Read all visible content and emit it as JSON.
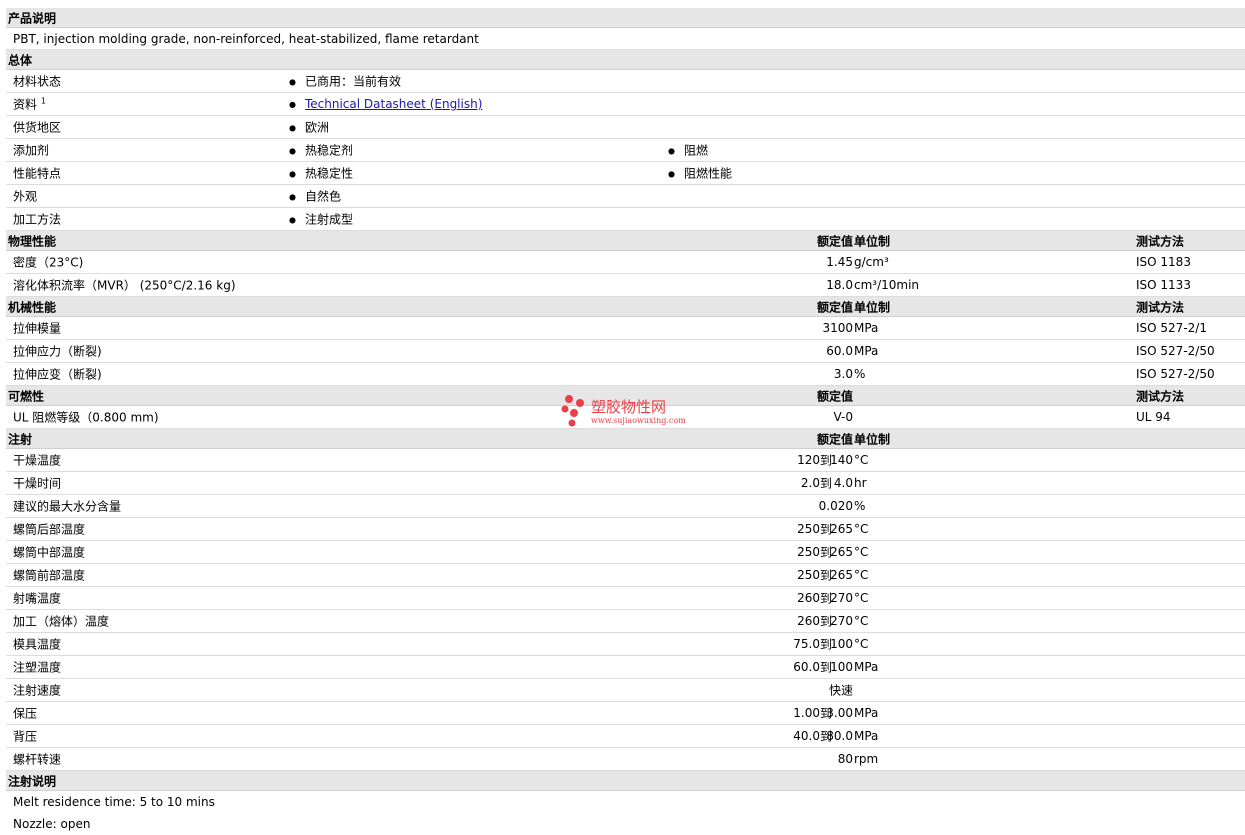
{
  "product": {
    "header": "产品说明",
    "text": "PBT, injection molding grade, non-reinforced, heat-stabilized, flame retardant"
  },
  "general": {
    "header": "总体",
    "rows": [
      {
        "label": "材料状态",
        "values": [
          "已商用：当前有效"
        ]
      },
      {
        "label": "资料",
        "sup": "1",
        "link": "Technical Datasheet (English)"
      },
      {
        "label": "供货地区",
        "values": [
          "欧洲"
        ]
      },
      {
        "label": "添加剂",
        "values": [
          "热稳定剂",
          "阻燃"
        ]
      },
      {
        "label": "性能特点",
        "values": [
          "热稳定性",
          "阻燃性能"
        ]
      },
      {
        "label": "外观",
        "values": [
          "自然色"
        ]
      },
      {
        "label": "加工方法",
        "values": [
          "注射成型"
        ]
      }
    ]
  },
  "physical": {
    "header": "物理性能",
    "col_value": "额定值",
    "col_unit": "单位制",
    "col_test": "测试方法",
    "rows": [
      {
        "label": "密度（23°C)",
        "value": "1.45",
        "unit": "g/cm³",
        "test": "ISO 1183"
      },
      {
        "label": "溶化体积流率（MVR） (250°C/2.16 kg)",
        "value": "18.0",
        "unit": "cm³/10min",
        "test": "ISO 1133"
      }
    ]
  },
  "mechanical": {
    "header": "机械性能",
    "col_value": "额定值",
    "col_unit": "单位制",
    "col_test": "测试方法",
    "rows": [
      {
        "label": "拉伸模量",
        "value": "3100",
        "unit": "MPa",
        "test": "ISO 527-2/1"
      },
      {
        "label": "拉伸应力（断裂)",
        "value": "60.0",
        "unit": "MPa",
        "test": "ISO 527-2/50"
      },
      {
        "label": "拉伸应变（断裂)",
        "value": "3.0",
        "unit": "%",
        "test": "ISO 527-2/50"
      }
    ]
  },
  "flammability": {
    "header": "可燃性",
    "col_value": "额定值",
    "col_test": "测试方法",
    "rows": [
      {
        "label": "UL 阻燃等级（0.800 mm)",
        "value": "V-0",
        "unit": "",
        "test": "UL 94"
      }
    ]
  },
  "injection": {
    "header": "注射",
    "col_value": "额定值",
    "col_unit": "单位制",
    "to_word": "到",
    "rows": [
      {
        "label": "干燥温度",
        "min": "120",
        "max": "140",
        "unit": "°C"
      },
      {
        "label": "干燥时间",
        "min": "2.0",
        "max": "4.0",
        "unit": "hr"
      },
      {
        "label": "建议的最大水分含量",
        "value": "0.020",
        "unit": "%"
      },
      {
        "label": "螺筒后部温度",
        "min": "250",
        "max": "265",
        "unit": "°C"
      },
      {
        "label": "螺筒中部温度",
        "min": "250",
        "max": "265",
        "unit": "°C"
      },
      {
        "label": "螺筒前部温度",
        "min": "250",
        "max": "265",
        "unit": "°C"
      },
      {
        "label": "射嘴温度",
        "min": "260",
        "max": "270",
        "unit": "°C"
      },
      {
        "label": "加工（熔体）温度",
        "min": "260",
        "max": "270",
        "unit": "°C"
      },
      {
        "label": "模具温度",
        "min": "75.0",
        "max": "100",
        "unit": "°C"
      },
      {
        "label": "注塑温度",
        "min": "60.0",
        "max": "100",
        "unit": "MPa"
      },
      {
        "label": "注射速度",
        "value": "快速",
        "unit": ""
      },
      {
        "label": "保压",
        "min": "1.00",
        "max": "3.00",
        "unit": "MPa"
      },
      {
        "label": "背压",
        "min": "40.0",
        "max": "80.0",
        "unit": "MPa"
      },
      {
        "label": "螺杆转速",
        "value": "80",
        "unit": "rpm"
      }
    ]
  },
  "notes": {
    "header": "注射说明",
    "lines": [
      "Melt residence time: 5 to 10 mins",
      "Nozzle: open"
    ]
  },
  "watermark": {
    "name": "塑胶物性网",
    "url": "www.sujiaowuxing.com",
    "color": "#e8404a"
  }
}
